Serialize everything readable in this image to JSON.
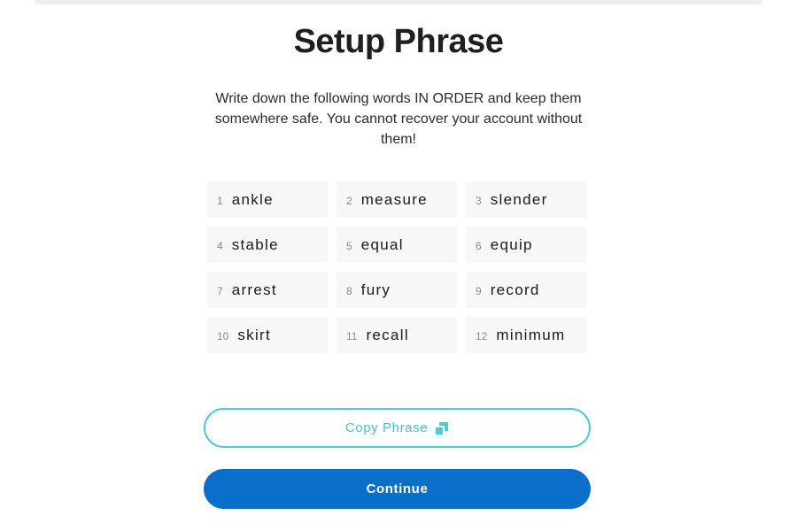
{
  "header": {
    "title": "Setup Phrase",
    "subtitle": "Write down the following words IN ORDER and keep them somewhere safe. You cannot recover your account without them!"
  },
  "phrase": {
    "words": [
      {
        "number": "1",
        "word": "ankle"
      },
      {
        "number": "2",
        "word": "measure"
      },
      {
        "number": "3",
        "word": "slender"
      },
      {
        "number": "4",
        "word": "stable"
      },
      {
        "number": "5",
        "word": "equal"
      },
      {
        "number": "6",
        "word": "equip"
      },
      {
        "number": "7",
        "word": "arrest"
      },
      {
        "number": "8",
        "word": "fury"
      },
      {
        "number": "9",
        "word": "record"
      },
      {
        "number": "10",
        "word": "skirt"
      },
      {
        "number": "11",
        "word": "recall"
      },
      {
        "number": "12",
        "word": "minimum"
      }
    ]
  },
  "actions": {
    "copy_label": "Copy Phrase",
    "copy_icon": "copy-icon",
    "continue_label": "Continue"
  },
  "colors": {
    "accent_teal": "#4cc9d3",
    "primary_blue": "#0a6fcb",
    "cell_bg": "#f7f7f7"
  }
}
